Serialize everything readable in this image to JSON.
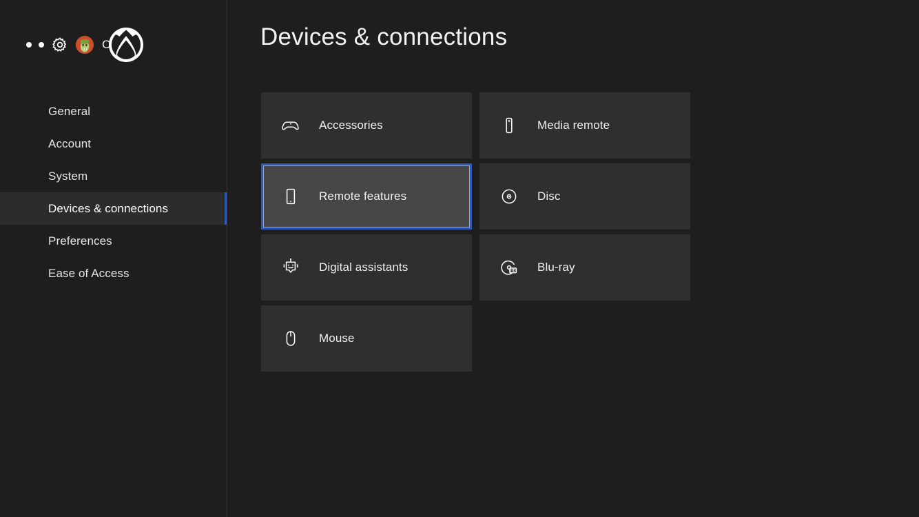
{
  "window": {
    "background_color": "#1e1e1e",
    "accent_color": "#2d56b5"
  },
  "sidebar": {
    "account": {
      "gamertag": "Co      26",
      "avatar_icon": "profile-avatar",
      "settings_icon": "gear-icon",
      "brand_icon": "xbox-logo",
      "dots": [
        "dot",
        "dot"
      ]
    },
    "items": [
      {
        "label": "General",
        "selected": false
      },
      {
        "label": "Account",
        "selected": false
      },
      {
        "label": "System",
        "selected": false
      },
      {
        "label": "Devices & connections",
        "selected": true
      },
      {
        "label": "Preferences",
        "selected": false
      },
      {
        "label": "Ease of Access",
        "selected": false
      }
    ]
  },
  "main": {
    "title": "Devices & connections",
    "tiles": [
      {
        "label": "Accessories",
        "icon": "gamepad-icon",
        "focused": false
      },
      {
        "label": "Media remote",
        "icon": "media-remote-icon",
        "focused": false
      },
      {
        "label": "Remote features",
        "icon": "remote-features-icon",
        "focused": true
      },
      {
        "label": "Disc",
        "icon": "disc-icon",
        "focused": false
      },
      {
        "label": "Digital assistants",
        "icon": "robot-icon",
        "focused": false
      },
      {
        "label": "Blu-ray",
        "icon": "bluray-icon",
        "focused": false
      },
      {
        "label": "Mouse",
        "icon": "mouse-icon",
        "focused": false
      }
    ]
  }
}
